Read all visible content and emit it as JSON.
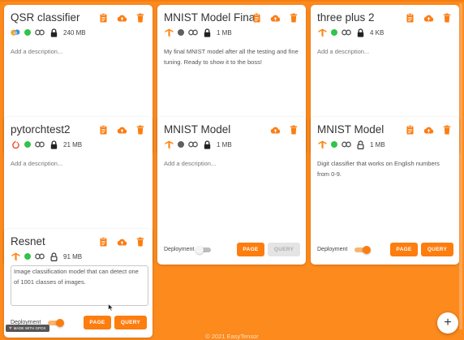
{
  "colors": {
    "accent": "#fd7d0f",
    "background": "#fd8a1d",
    "status_green": "#31c34b",
    "status_gray": "#5f5f5f"
  },
  "card_actions": {
    "document_icon": "document-icon",
    "upload_icon": "cloud-upload-icon",
    "delete_icon": "trash-icon"
  },
  "meta_icons": {
    "link_icon": "link-icon",
    "lock_icon": "lock-icon",
    "unlock_icon": "unlock-icon"
  },
  "labels": {
    "deployment": "Deployment",
    "page": "PAGE",
    "query": "QUERY"
  },
  "cards": [
    {
      "title": "QSR classifier",
      "framework_icon": "scikit-learn-icon",
      "status": "green",
      "lock": "locked",
      "size": "240 MB",
      "description": "Add a description...",
      "deployment": "on",
      "query_enabled": true
    },
    {
      "title": "MNIST Model Final",
      "framework_icon": "tensorflow-icon",
      "status": "gray",
      "lock": "locked",
      "size": "1 MB",
      "description": "My final MNIST model after all the testing and fine tuning. Ready to show it to the boss!",
      "deployment": "off",
      "query_enabled": true
    },
    {
      "title": "three plus 2",
      "framework_icon": "tensorflow-icon",
      "status": "green",
      "lock": "locked",
      "size": "4 KB",
      "description": "Add a description...",
      "deployment": "on",
      "query_enabled": true
    },
    {
      "title": "pytorchtest2",
      "framework_icon": "pytorch-icon",
      "status": "green",
      "lock": "locked",
      "size": "21 MB",
      "description": "Add a description...",
      "deployment": "on",
      "query_enabled": true
    },
    {
      "title": "MNIST Model",
      "framework_icon": "tensorflow-icon",
      "status": "gray",
      "lock": "locked",
      "size": "1 MB",
      "description": "Add a description...",
      "deployment": "off",
      "query_enabled": false
    },
    {
      "title": "MNIST Model",
      "framework_icon": "tensorflow-icon",
      "status": "green",
      "lock": "unlocked",
      "size": "1 MB",
      "description": "Digit classifier that works on English numbers from 0-9.",
      "deployment": "on",
      "query_enabled": true
    },
    {
      "title": "Resnet",
      "framework_icon": "tensorflow-icon",
      "status": "green",
      "lock": "unlocked",
      "size": "91 MB",
      "description": "Image classification model that can detect one of 1001 classes of images.",
      "deployment": "on",
      "query_enabled": true
    }
  ],
  "footer": {
    "copyright": "© 2021 EasyTensor"
  },
  "fab": {
    "label": "+"
  },
  "badge": {
    "text": "MADE WITH GPOX"
  }
}
